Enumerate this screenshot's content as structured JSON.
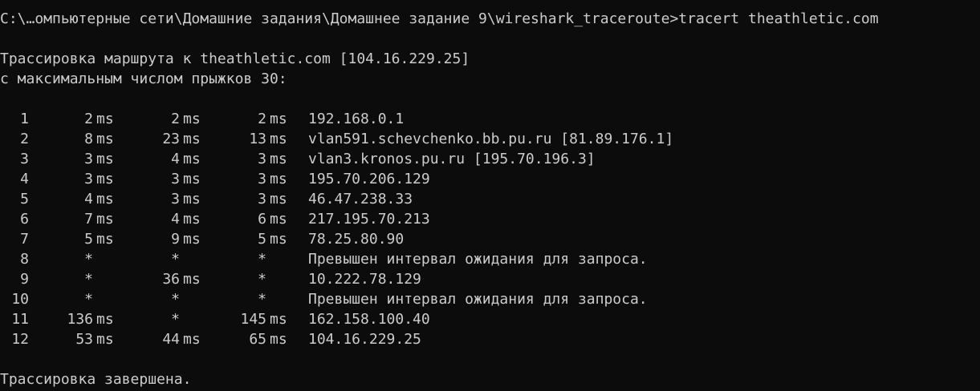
{
  "window": {
    "background": "#0c0c0c",
    "foreground": "#cccccc"
  },
  "prompt": {
    "path": "C:\\…омпьютерные сети\\Домашние задания\\Домашнее задание 9\\wireshark_traceroute>",
    "command": "tracert theathletic.com"
  },
  "header": {
    "line1": "Трассировка маршрута к theathletic.com [104.16.229.25]",
    "line2": "с максимальным числом прыжков 30:"
  },
  "hops": [
    {
      "num": "1",
      "rtt1": "2",
      "ms1": "ms",
      "rtt2": "2",
      "ms2": "ms",
      "rtt3": "2",
      "ms3": "ms",
      "host": "192.168.0.1"
    },
    {
      "num": "2",
      "rtt1": "8",
      "ms1": "ms",
      "rtt2": "23",
      "ms2": "ms",
      "rtt3": "13",
      "ms3": "ms",
      "host": "vlan591.schevchenko.bb.pu.ru [81.89.176.1]"
    },
    {
      "num": "3",
      "rtt1": "3",
      "ms1": "ms",
      "rtt2": "4",
      "ms2": "ms",
      "rtt3": "3",
      "ms3": "ms",
      "host": "vlan3.kronos.pu.ru [195.70.196.3]"
    },
    {
      "num": "4",
      "rtt1": "3",
      "ms1": "ms",
      "rtt2": "3",
      "ms2": "ms",
      "rtt3": "3",
      "ms3": "ms",
      "host": "195.70.206.129"
    },
    {
      "num": "5",
      "rtt1": "4",
      "ms1": "ms",
      "rtt2": "3",
      "ms2": "ms",
      "rtt3": "3",
      "ms3": "ms",
      "host": "46.47.238.33"
    },
    {
      "num": "6",
      "rtt1": "7",
      "ms1": "ms",
      "rtt2": "4",
      "ms2": "ms",
      "rtt3": "6",
      "ms3": "ms",
      "host": "217.195.70.213"
    },
    {
      "num": "7",
      "rtt1": "5",
      "ms1": "ms",
      "rtt2": "9",
      "ms2": "ms",
      "rtt3": "5",
      "ms3": "ms",
      "host": "78.25.80.90"
    },
    {
      "num": "8",
      "rtt1": "*",
      "ms1": "",
      "rtt2": "*",
      "ms2": "",
      "rtt3": "*",
      "ms3": "",
      "host": "Превышен интервал ожидания для запроса."
    },
    {
      "num": "9",
      "rtt1": "*",
      "ms1": "",
      "rtt2": "36",
      "ms2": "ms",
      "rtt3": "*",
      "ms3": "",
      "host": "10.222.78.129"
    },
    {
      "num": "10",
      "rtt1": "*",
      "ms1": "",
      "rtt2": "*",
      "ms2": "",
      "rtt3": "*",
      "ms3": "",
      "host": "Превышен интервал ожидания для запроса."
    },
    {
      "num": "11",
      "rtt1": "136",
      "ms1": "ms",
      "rtt2": "*",
      "ms2": "",
      "rtt3": "145",
      "ms3": "ms",
      "host": "162.158.100.40"
    },
    {
      "num": "12",
      "rtt1": "53",
      "ms1": "ms",
      "rtt2": "44",
      "ms2": "ms",
      "rtt3": "65",
      "ms3": "ms",
      "host": "104.16.229.25"
    }
  ],
  "footer": {
    "done": "Трассировка завершена."
  }
}
